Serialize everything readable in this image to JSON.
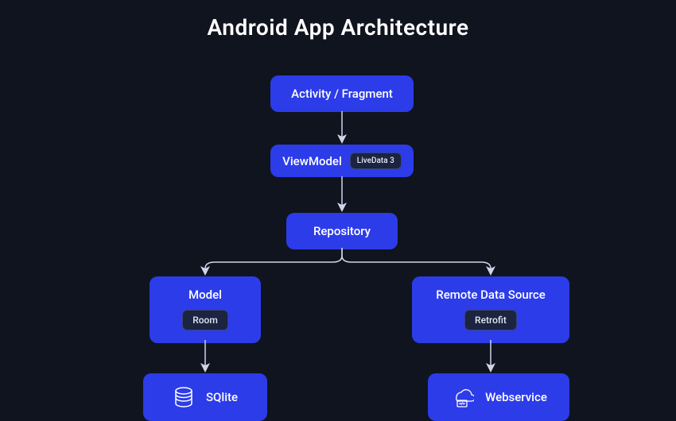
{
  "title": "Android App Architecture",
  "nodes": {
    "activity": {
      "label": "Activity / Fragment"
    },
    "viewmodel": {
      "label": "ViewModel",
      "chip": "LiveData 3"
    },
    "repository": {
      "label": "Repository"
    },
    "model": {
      "label": "Model",
      "chip": "Room"
    },
    "remote": {
      "label": "Remote Data Source",
      "chip": "Retrofit"
    },
    "sqlite": {
      "label": "SQlite"
    },
    "webservice": {
      "label": "Webservice"
    }
  },
  "edges": [
    {
      "from": "activity",
      "to": "viewmodel"
    },
    {
      "from": "viewmodel",
      "to": "repository"
    },
    {
      "from": "repository",
      "to": "model"
    },
    {
      "from": "repository",
      "to": "remote"
    },
    {
      "from": "model",
      "to": "sqlite"
    },
    {
      "from": "remote",
      "to": "webservice"
    }
  ],
  "colors": {
    "background": "#10141f",
    "node": "#2c3ce9",
    "chip_bg": "#1b2440",
    "text": "#ffffff"
  }
}
